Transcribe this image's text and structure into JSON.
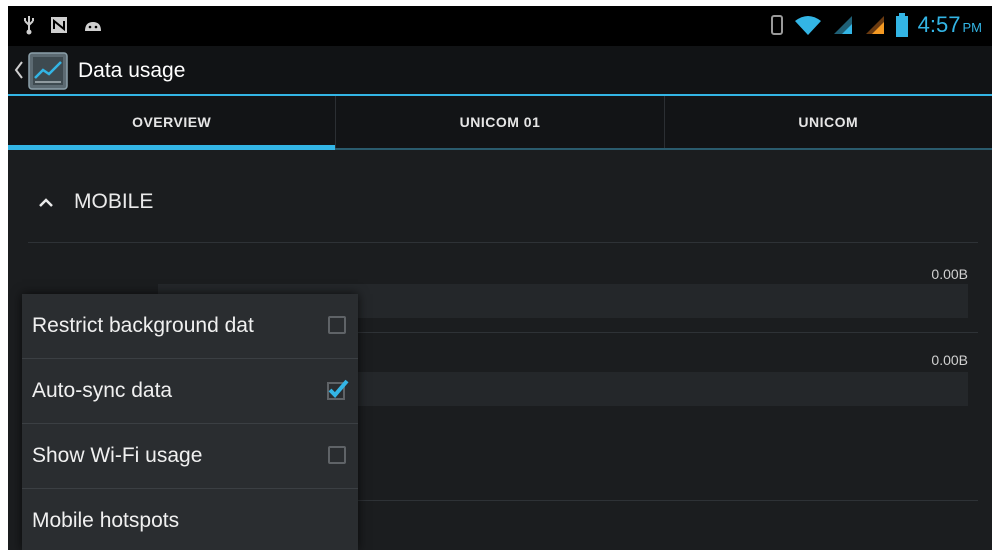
{
  "status_bar": {
    "time": "4:57",
    "ampm": "PM"
  },
  "action_bar": {
    "title": "Data usage"
  },
  "tabs": [
    {
      "label": "OVERVIEW",
      "active": true
    },
    {
      "label": "UNICOM 01",
      "active": false
    },
    {
      "label": "UNICOM",
      "active": false
    }
  ],
  "section": {
    "title": "MOBILE"
  },
  "usage_rows": [
    {
      "value": "0.00B"
    },
    {
      "value": "0.00B"
    }
  ],
  "menu": {
    "items": [
      {
        "label": "Restrict background dat",
        "checkbox": true,
        "checked": false
      },
      {
        "label": "Auto-sync data",
        "checkbox": true,
        "checked": true
      },
      {
        "label": "Show Wi-Fi usage",
        "checkbox": true,
        "checked": false
      },
      {
        "label": "Mobile hotspots",
        "checkbox": false,
        "checked": false
      }
    ]
  },
  "colors": {
    "accent": "#33b5e5",
    "background": "#1b1d1f",
    "menu_background": "#2a2d30"
  }
}
